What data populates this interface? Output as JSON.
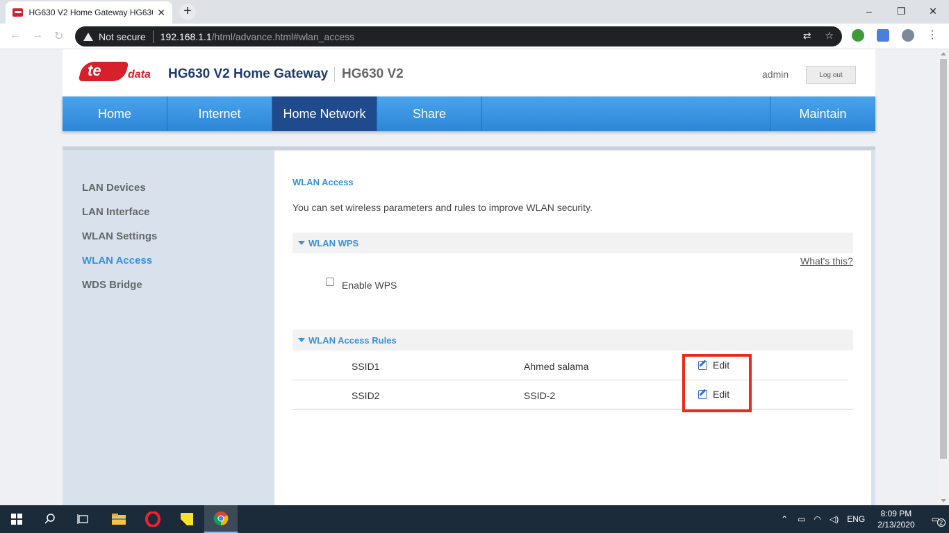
{
  "browser": {
    "tab_title": "HG630 V2 Home Gateway HG630",
    "tab_close": "✕",
    "new_tab": "+",
    "security_label": "Not secure",
    "url_host": "192.168.1.1",
    "url_path": "/html/advance.html#wlan_access",
    "window_controls": [
      "–",
      "❐",
      "✕"
    ]
  },
  "header": {
    "logo_mark": "te",
    "logo_text": "data",
    "product_title": "HG630 V2 Home Gateway",
    "product_model": "HG630 V2",
    "username": "admin",
    "logout_label": "Log out"
  },
  "nav": {
    "items": [
      "Home",
      "Internet",
      "Home Network",
      "Share"
    ],
    "active": "Home Network",
    "maintain": "Maintain"
  },
  "sidebar": {
    "items": [
      "LAN Devices",
      "LAN Interface",
      "WLAN Settings",
      "WLAN Access",
      "WDS Bridge"
    ],
    "active": "WLAN Access"
  },
  "main": {
    "title": "WLAN Access",
    "description": "You can set wireless parameters and rules to improve WLAN security.",
    "wps_section": "WLAN WPS",
    "whats_this": "What's this?",
    "wps_checkbox_label": "Enable WPS",
    "rules_section": "WLAN Access Rules",
    "rules": [
      {
        "ssid": "SSID1",
        "name": "Ahmed salama",
        "action": "Edit"
      },
      {
        "ssid": "SSID2",
        "name": "SSID-2",
        "action": "Edit"
      }
    ]
  },
  "taskbar": {
    "language": "ENG",
    "time": "8:09 PM",
    "date": "2/13/2020",
    "notification_count": "2"
  },
  "colors": {
    "accent": "#3591e0",
    "nav_blue": "#2d86d6",
    "nav_active": "#1f4b8d",
    "brand_red": "#d6202b",
    "highlight": "#ee2b17"
  }
}
